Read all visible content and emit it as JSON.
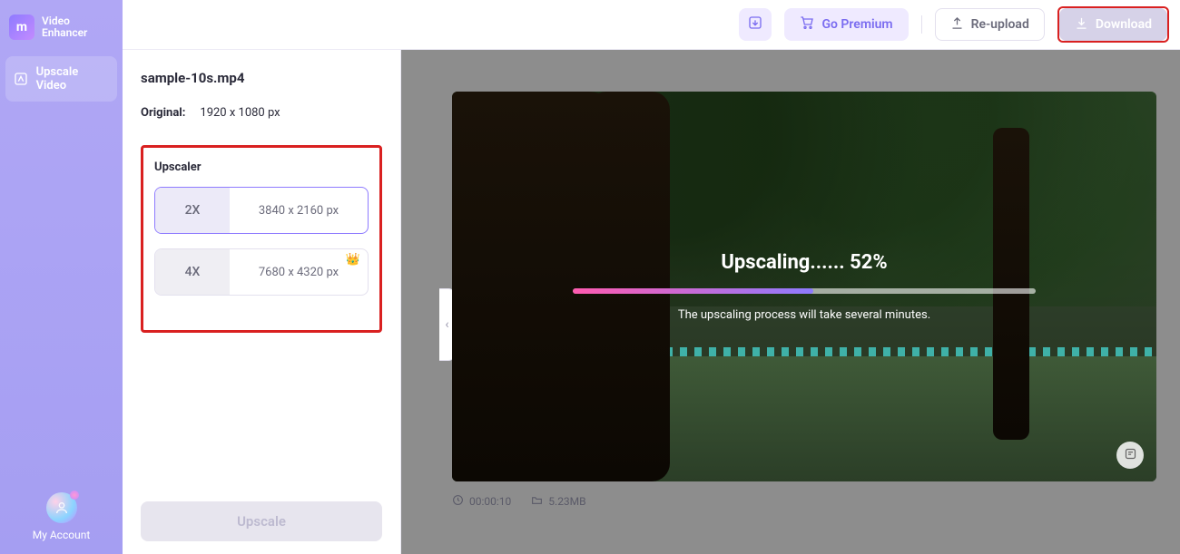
{
  "brand": {
    "name": "Video\nEnhancer",
    "mark": "m"
  },
  "sidebar": {
    "items": [
      {
        "label": "Upscale Video"
      }
    ],
    "account_label": "My Account"
  },
  "header": {
    "premium_label": "Go Premium",
    "reupload_label": "Re-upload",
    "download_label": "Download"
  },
  "panel": {
    "filename": "sample-10s.mp4",
    "original_label": "Original:",
    "original_dims": "1920 x 1080 px",
    "upscaler_title": "Upscaler",
    "options": [
      {
        "mult": "2X",
        "res": "3840 x 2160 px",
        "premium": false
      },
      {
        "mult": "4X",
        "res": "7680 x 4320 px",
        "premium": true
      }
    ],
    "upscale_button": "Upscale"
  },
  "preview": {
    "status_title": "Upscaling...... 52%",
    "progress_pct": 52,
    "status_sub": "The upscaling process will take several minutes.",
    "duration": "00:00:10",
    "filesize": "5.23MB"
  }
}
